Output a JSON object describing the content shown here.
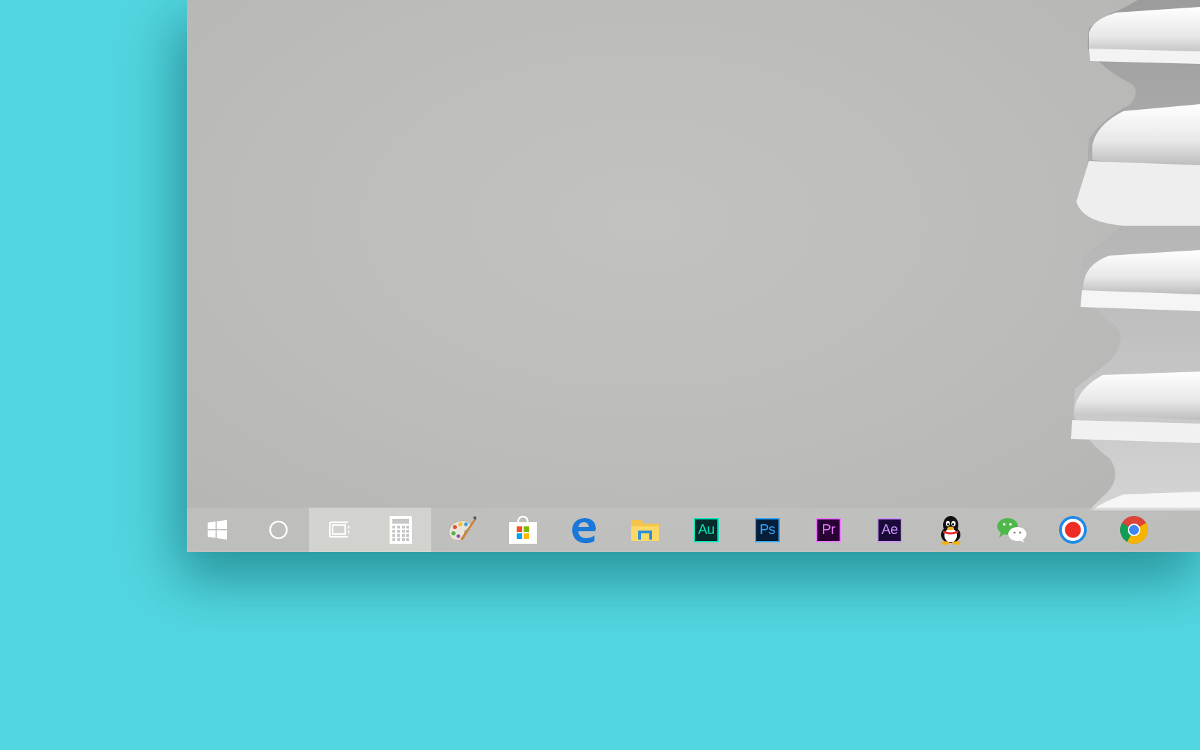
{
  "taskbar": {
    "items": [
      {
        "id": "start",
        "icon": "windows-logo-icon",
        "active": false
      },
      {
        "id": "search",
        "icon": "cortana-circle-icon",
        "active": false
      },
      {
        "id": "task-view",
        "icon": "task-view-icon",
        "active": true
      },
      {
        "id": "calculator",
        "icon": "calculator-icon",
        "active": true
      },
      {
        "id": "paint",
        "icon": "paint-palette-icon",
        "active": false
      },
      {
        "id": "store",
        "icon": "microsoft-store-icon",
        "active": false
      },
      {
        "id": "edge",
        "icon": "edge-icon",
        "active": false
      },
      {
        "id": "file-explorer",
        "icon": "folder-icon",
        "active": false
      },
      {
        "id": "audition",
        "icon": "adobe-audition-icon",
        "label": "Au",
        "bg": "#062b2a",
        "fg": "#00e4bb",
        "active": false
      },
      {
        "id": "photoshop",
        "icon": "adobe-photoshop-icon",
        "label": "Ps",
        "bg": "#061e3a",
        "fg": "#31a8ff",
        "active": false
      },
      {
        "id": "premiere",
        "icon": "adobe-premiere-icon",
        "label": "Pr",
        "bg": "#2a0034",
        "fg": "#e77bff",
        "active": false
      },
      {
        "id": "after-effects",
        "icon": "adobe-after-effects-icon",
        "label": "Ae",
        "bg": "#1a0a3a",
        "fg": "#d291ff",
        "active": false
      },
      {
        "id": "qq",
        "icon": "qq-penguin-icon",
        "active": false
      },
      {
        "id": "wechat",
        "icon": "wechat-icon",
        "active": false
      },
      {
        "id": "recorder",
        "icon": "record-icon",
        "active": false
      },
      {
        "id": "chrome",
        "icon": "chrome-icon",
        "active": false
      }
    ]
  },
  "colors": {
    "background": "#52d6df",
    "desktop": "#bcbcba"
  }
}
